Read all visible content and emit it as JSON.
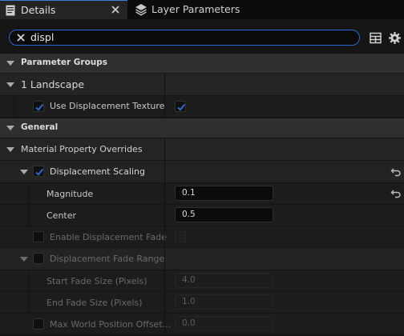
{
  "tabs": {
    "details": "Details",
    "layer_parameters": "Layer Parameters"
  },
  "search": {
    "value": "displ"
  },
  "categories": {
    "parameter_groups": "Parameter Groups",
    "general": "General"
  },
  "groups": {
    "landscape": "1 Landscape",
    "material_property_overrides": "Material Property Overrides"
  },
  "properties": {
    "use_displacement_texture": {
      "label": "Use Displacement Texture",
      "checked": true,
      "value_checked": true
    },
    "displacement_scaling": {
      "label": "Displacement Scaling",
      "checked": true
    },
    "magnitude": {
      "label": "Magnitude",
      "value": "0.1"
    },
    "center": {
      "label": "Center",
      "value": "0.5"
    },
    "enable_displacement_fade": {
      "label": "Enable Displacement Fade",
      "checked": false
    },
    "displacement_fade_range": {
      "label": "Displacement Fade Range",
      "checked": false
    },
    "start_fade_size": {
      "label": "Start Fade Size (Pixels)",
      "value": "4.0"
    },
    "end_fade_size": {
      "label": "End Fade Size (Pixels)",
      "value": "1.0"
    },
    "max_world_position_offset": {
      "label": "Max World Position Offset...",
      "value": "0.0"
    }
  },
  "colors": {
    "accent": "#2a6ad6",
    "checkbox": "#2a6ad6",
    "panel": "#1c1c1c",
    "category": "#2f2f2f"
  }
}
